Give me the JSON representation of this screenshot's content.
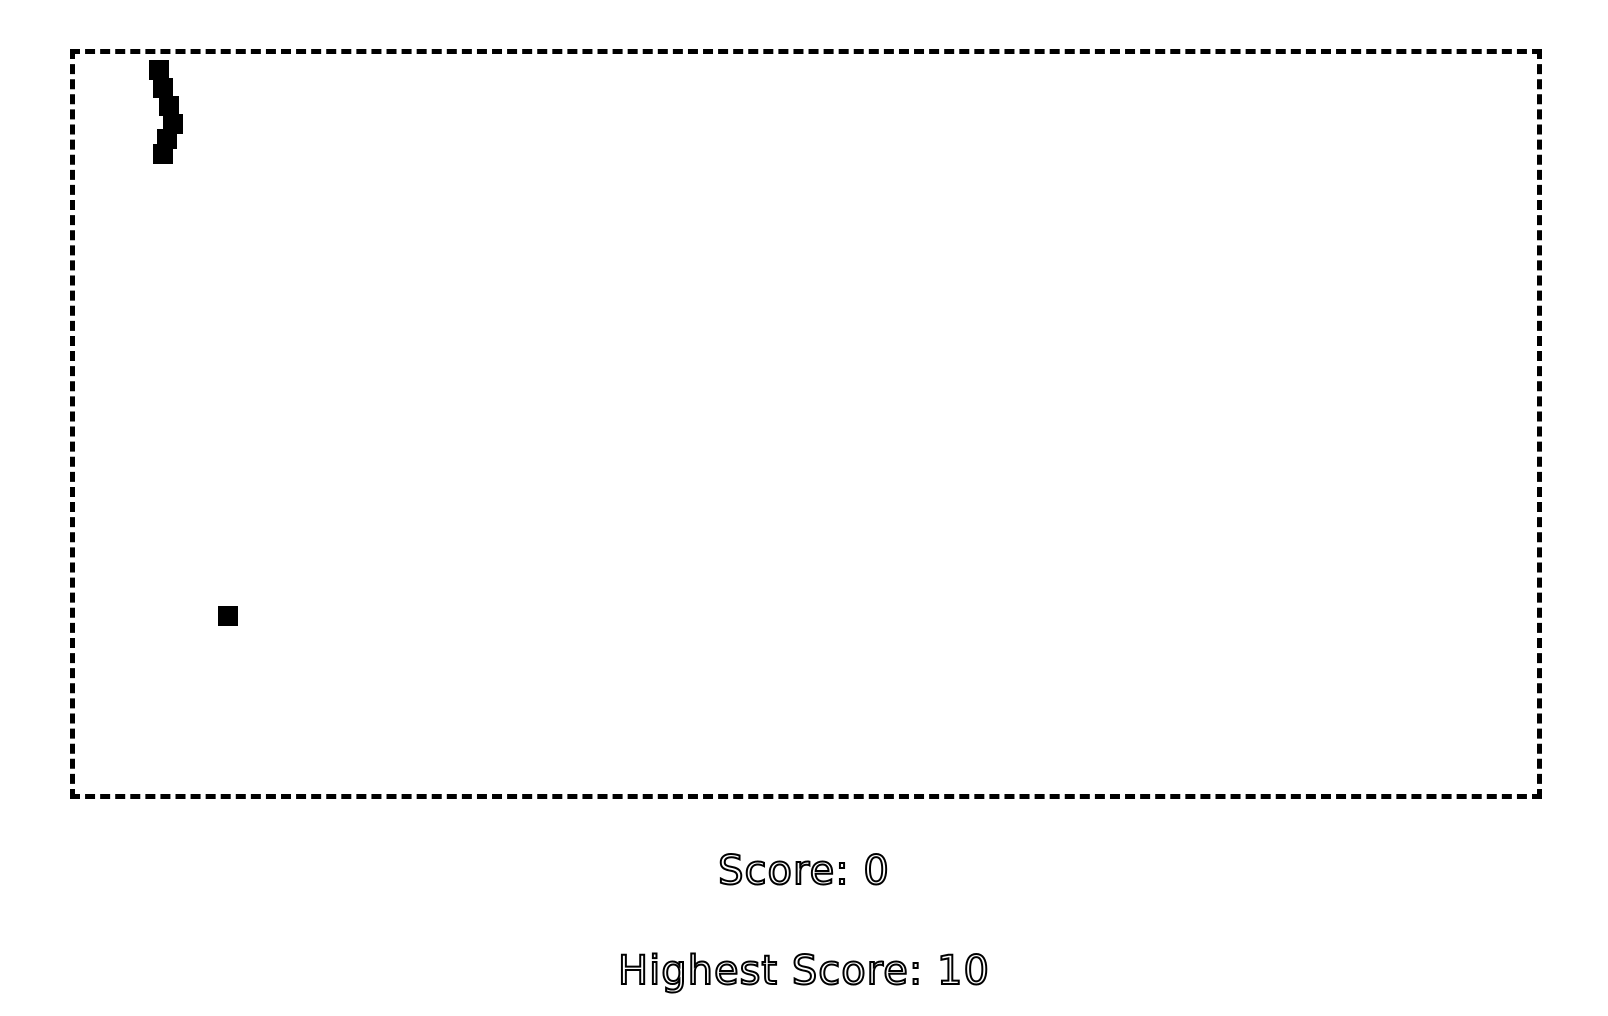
{
  "game": {
    "title": "",
    "score_text": "Score: 0",
    "high_score_text": "Highest Score: 10",
    "score": 0,
    "high_score": 10,
    "snake_length": 6,
    "colors": {
      "snake": "#000000",
      "food": "#000000",
      "border": "#000000",
      "background": "#ffffff"
    }
  }
}
